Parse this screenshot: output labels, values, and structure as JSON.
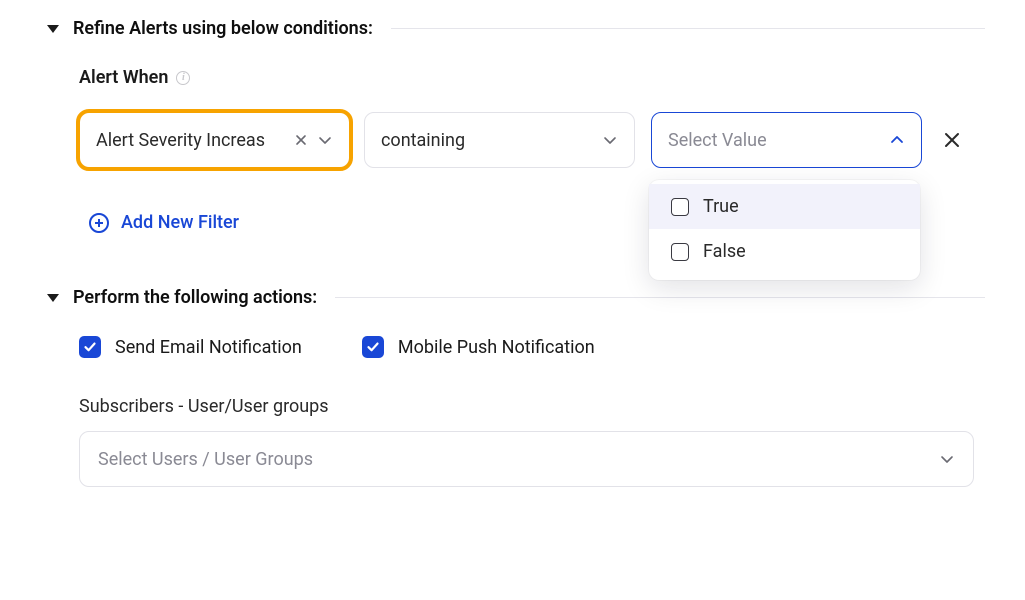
{
  "refine": {
    "title": "Refine Alerts using below conditions:",
    "alertWhenLabel": "Alert When",
    "filter": {
      "field": "Alert Severity Increas",
      "operator": "containing",
      "valuePlaceholder": "Select Value",
      "options": [
        "True",
        "False"
      ]
    },
    "addFilter": "Add New Filter"
  },
  "perform": {
    "title": "Perform the following actions:",
    "emailLabel": "Send Email Notification",
    "pushLabel": "Mobile Push Notification",
    "subscribersLabel": "Subscribers - User/User groups",
    "subscribersPlaceholder": "Select Users / User Groups"
  }
}
